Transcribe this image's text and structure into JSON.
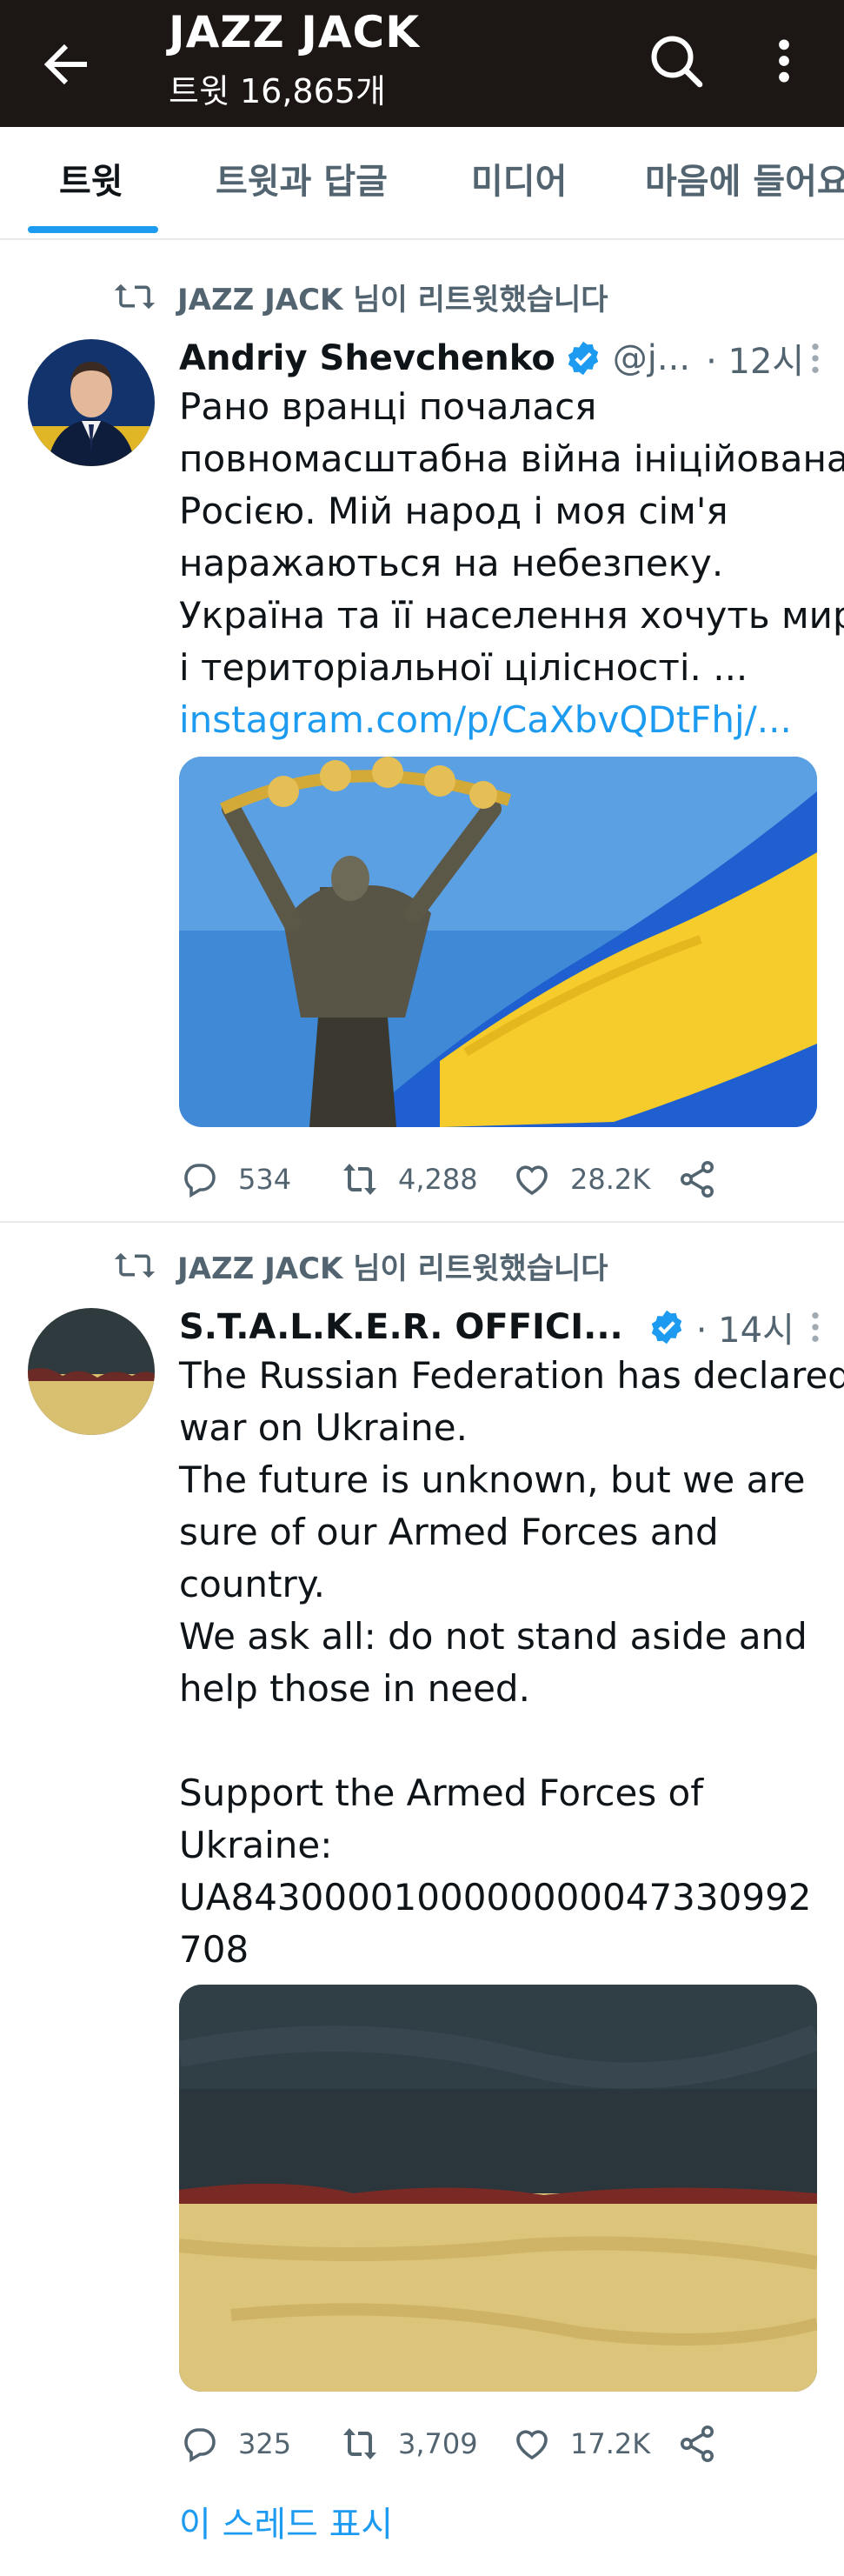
{
  "header": {
    "title": "JAZZ JACK",
    "subtitle": "트윗 16,865개",
    "back_icon": "arrow-left-icon",
    "search_icon": "search-icon",
    "more_icon": "more-vertical-icon"
  },
  "tabs": [
    {
      "label": "트윗",
      "active": true
    },
    {
      "label": "트윗과 답글",
      "active": false
    },
    {
      "label": "미디어",
      "active": false
    },
    {
      "label": "마음에 들어요",
      "active": false
    }
  ],
  "colors": {
    "header_bg": "#1c1714",
    "accent": "#1d9bf0",
    "secondary_text": "#536471",
    "ukraine_blue": "#1f5fcf",
    "ukraine_yellow": "#f5cc2c"
  },
  "tweets": [
    {
      "retweet_text": "JAZZ JACK 님이 리트윗했습니다",
      "author_name": "Andriy Shevchenko",
      "verified": true,
      "handle": "@j...",
      "time": "· 12시",
      "body_lines": [
        "Рано вранці почалася",
        "повномасштабна війна ініційована",
        "Росією. Мій народ і моя сім'я",
        "наражаються на небезпеку.",
        "Україна та її населення хочуть миру",
        "і територіальної цілісності. ..."
      ],
      "link_text": "instagram.com/p/CaXbvQDtFhj/...",
      "replies": "534",
      "retweets": "4,288",
      "likes": "28.2K"
    },
    {
      "retweet_text": "JAZZ JACK 님이 리트윗했습니다",
      "author_name": "S.T.A.L.K.E.R. OFFICI...",
      "verified": true,
      "time": "· 14시",
      "body_lines": [
        "The Russian Federation has declared",
        "war on Ukraine.",
        "The future is unknown, but we are",
        "sure of our Armed Forces and",
        "country.",
        "We ask all: do not stand aside and",
        "help those in need.",
        "",
        "Support the Armed Forces of",
        "Ukraine:",
        "UA84300001000000000473309​92",
        "708"
      ],
      "replies": "325",
      "retweets": "3,709",
      "likes": "17.2K",
      "show_thread": "이 스레드 표시"
    }
  ]
}
